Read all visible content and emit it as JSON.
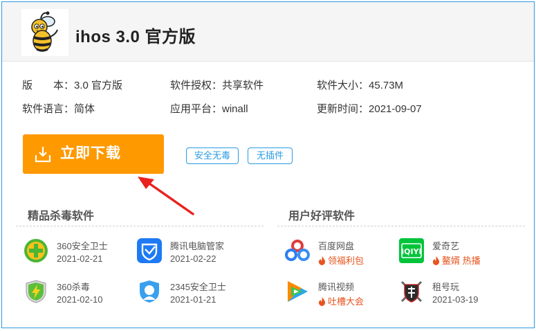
{
  "app": {
    "title": "ihos 3.0 官方版"
  },
  "info": {
    "version_label": "版　　本：",
    "version_value": "3.0 官方版",
    "license_label": "软件授权：",
    "license_value": "共享软件",
    "size_label": "软件大小：",
    "size_value": "45.73M",
    "language_label": "软件语言：",
    "language_value": "简体",
    "platform_label": "应用平台：",
    "platform_value": "winall",
    "updated_label": "更新时间：",
    "updated_value": "2021-09-07"
  },
  "download": {
    "label": "立即下载",
    "color": "#ff9900"
  },
  "badges": [
    "安全无毒",
    "无插件"
  ],
  "sections": {
    "antivirus": {
      "title": "精品杀毒软件",
      "items": [
        {
          "name": "360安全卫士",
          "date": "2021-02-21",
          "icon": "360-safeguard-icon"
        },
        {
          "name": "腾讯电脑管家",
          "date": "2021-02-22",
          "icon": "tencent-pc-manager-icon"
        },
        {
          "name": "360杀毒",
          "date": "2021-02-10",
          "icon": "360-antivirus-icon"
        },
        {
          "name": "2345安全卫士",
          "date": "2021-01-21",
          "icon": "2345-safeguard-icon"
        }
      ]
    },
    "popular": {
      "title": "用户好评软件",
      "items": [
        {
          "name": "百度网盘",
          "tag": "领福利包",
          "icon": "baidu-netdisk-icon"
        },
        {
          "name": "爱奇艺",
          "tag": "鳌婿 热播",
          "icon": "iqiyi-icon"
        },
        {
          "name": "腾讯视频",
          "tag": "吐槽大会",
          "icon": "tencent-video-icon"
        },
        {
          "name": "租号玩",
          "date": "2021-03-19",
          "icon": "zuhaowan-icon"
        }
      ]
    }
  },
  "colors": {
    "accent": "#2a9be3",
    "download": "#ff9900",
    "tag": "#e8541e",
    "arrow": "#e8231f"
  }
}
